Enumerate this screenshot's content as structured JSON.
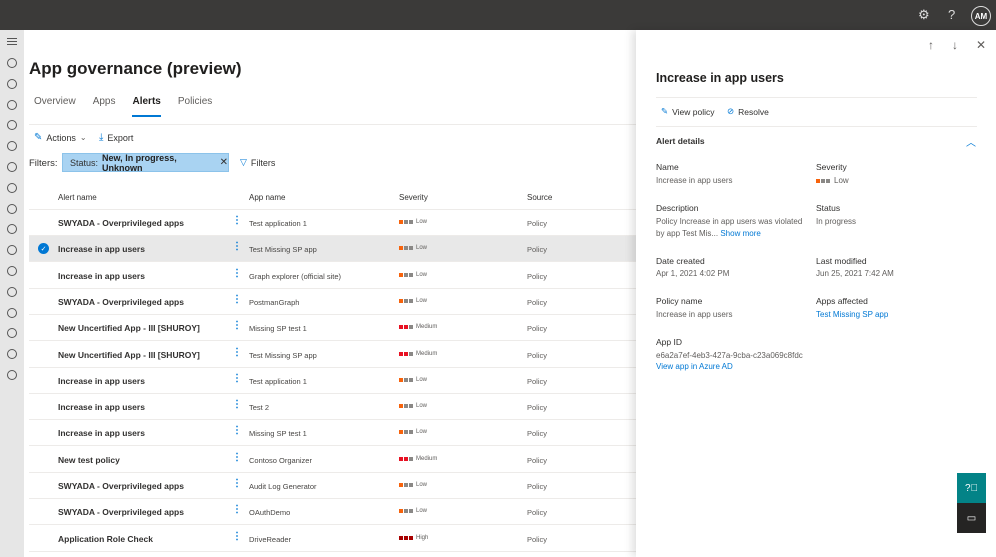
{
  "topbar": {
    "settings_icon": "gear-icon",
    "help_icon": "question-icon",
    "avatar": "AM"
  },
  "page": {
    "title": "App governance (preview)"
  },
  "tabs": [
    {
      "label": "Overview"
    },
    {
      "label": "Apps"
    },
    {
      "label": "Alerts",
      "active": true
    },
    {
      "label": "Policies"
    }
  ],
  "toolbar": {
    "actions": "Actions",
    "export": "Export"
  },
  "filters": {
    "label": "Filters:",
    "status_key": "Status:",
    "status_value": "New, In progress, Unknown",
    "filters_button": "Filters"
  },
  "table": {
    "columns": [
      "Alert name",
      "App name",
      "Severity",
      "Source"
    ],
    "rows": [
      {
        "alert": "SWYADA - Overprivileged apps",
        "app": "Test application 1",
        "severity": "Low",
        "source": "Policy"
      },
      {
        "alert": "Increase in app users",
        "app": "Test Missing SP app",
        "severity": "Low",
        "source": "Policy",
        "selected": true
      },
      {
        "alert": "Increase in app users",
        "app": "Graph explorer (official site)",
        "severity": "Low",
        "source": "Policy"
      },
      {
        "alert": "SWYADA - Overprivileged apps",
        "app": "PostmanGraph",
        "severity": "Low",
        "source": "Policy"
      },
      {
        "alert": "New Uncertified App - III [SHUROY]",
        "app": "Missing SP test 1",
        "severity": "Medium",
        "source": "Policy"
      },
      {
        "alert": "New Uncertified App - III [SHUROY]",
        "app": "Test Missing SP app",
        "severity": "Medium",
        "source": "Policy"
      },
      {
        "alert": "Increase in app users",
        "app": "Test application 1",
        "severity": "Low",
        "source": "Policy"
      },
      {
        "alert": "Increase in app users",
        "app": "Test 2",
        "severity": "Low",
        "source": "Policy"
      },
      {
        "alert": "Increase in app users",
        "app": "Missing SP test 1",
        "severity": "Low",
        "source": "Policy"
      },
      {
        "alert": "New test policy",
        "app": "Contoso Organizer",
        "severity": "Medium",
        "source": "Policy"
      },
      {
        "alert": "SWYADA - Overprivileged apps",
        "app": "Audit Log Generator",
        "severity": "Low",
        "source": "Policy"
      },
      {
        "alert": "SWYADA - Overprivileged apps",
        "app": "OAuthDemo",
        "severity": "Low",
        "source": "Policy"
      },
      {
        "alert": "Application Role Check",
        "app": "DriveReader",
        "severity": "High",
        "source": "Policy"
      }
    ]
  },
  "severity_colors": {
    "Low": [
      "#f7630c",
      "#8a8886",
      "#8a8886"
    ],
    "Medium": [
      "#e81123",
      "#e81123",
      "#8a8886"
    ],
    "High": [
      "#a80000",
      "#a80000",
      "#a80000"
    ]
  },
  "panel": {
    "title": "Increase in app users",
    "view_policy": "View policy",
    "resolve": "Resolve",
    "section": "Alert details",
    "name_label": "Name",
    "name_value": "Increase in app users",
    "severity_label": "Severity",
    "severity_value": "Low",
    "description_label": "Description",
    "description_value": "Policy Increase in app users was violated by app Test Mis...",
    "show_more": "Show more",
    "status_label": "Status",
    "status_value": "In progress",
    "date_created_label": "Date created",
    "date_created_value": "Apr 1, 2021 4:02 PM",
    "last_modified_label": "Last modified",
    "last_modified_value": "Jun 25, 2021 7:42 AM",
    "policy_name_label": "Policy name",
    "policy_name_value": "Increase in app users",
    "apps_affected_label": "Apps affected",
    "apps_affected_value": "Test Missing SP app",
    "app_id_label": "App ID",
    "app_id_value": "e6a2a7ef-4eb3-427a-9cba-c23a069c8fdc",
    "azure_link": "View app in Azure AD"
  },
  "colors": {
    "accent": "#0078d4",
    "topbar": "#3b3a39",
    "help_fab": "#038387",
    "feedback_fab": "#252423"
  }
}
